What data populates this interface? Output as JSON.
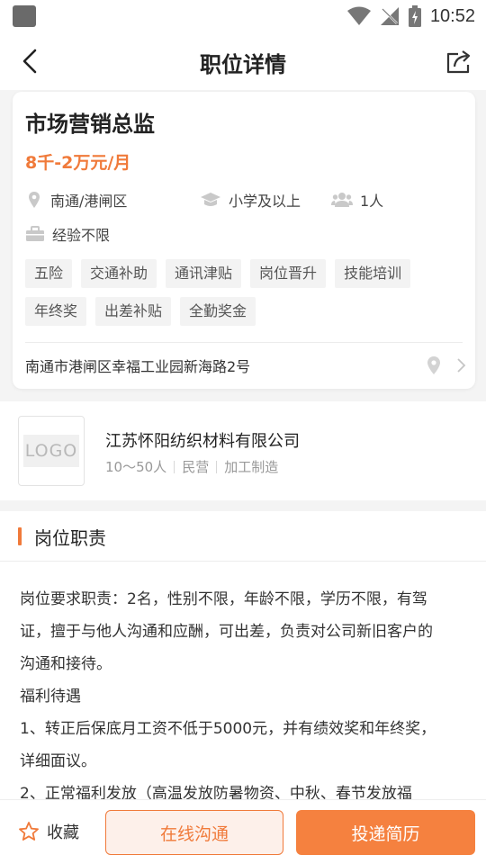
{
  "status_bar": {
    "time": "10:52"
  },
  "nav": {
    "title": "职位详情"
  },
  "job": {
    "title": "市场营销总监",
    "salary": "8千-2万元/月",
    "location": "南通/港闸区",
    "education": "小学及以上",
    "headcount": "1人",
    "experience": "经验不限",
    "tags": [
      "五险",
      "交通补助",
      "通讯津贴",
      "岗位晋升",
      "技能培训",
      "年终奖",
      "出差补贴",
      "全勤奖金"
    ],
    "address": "南通市港闸区幸福工业园新海路2号"
  },
  "company": {
    "logo_text": "LOGO",
    "name": "江苏怀阳纺织材料有限公司",
    "size": "10～50人",
    "type": "民营",
    "industry": "加工制造"
  },
  "duty": {
    "title": "岗位职责",
    "lines": [
      "岗位要求职责：2名，性别不限，年龄不限，学历不限，有驾",
      "证，擅于与他人沟通和应酬，可出差，负责对公司新旧客户的",
      "沟通和接待。",
      "福利待遇",
      "1、转正后保底月工资不低于5000元，并有绩效奖和年终奖，",
      "详细面议。",
      "2、正常福利发放（高温发放防暑物资、中秋、春节发放福"
    ]
  },
  "bottom": {
    "favorite_label": "收藏",
    "chat_label": "在线沟通",
    "apply_label": "投递简历"
  },
  "colors": {
    "accent": "#f07a3a",
    "apply_bg": "#f5813f"
  },
  "icons": [
    "back-icon",
    "share-icon",
    "location-icon",
    "education-icon",
    "people-icon",
    "briefcase-icon",
    "map-pin-icon",
    "chevron-right-icon",
    "star-icon",
    "wifi-icon",
    "no-signal-icon",
    "battery-icon"
  ]
}
